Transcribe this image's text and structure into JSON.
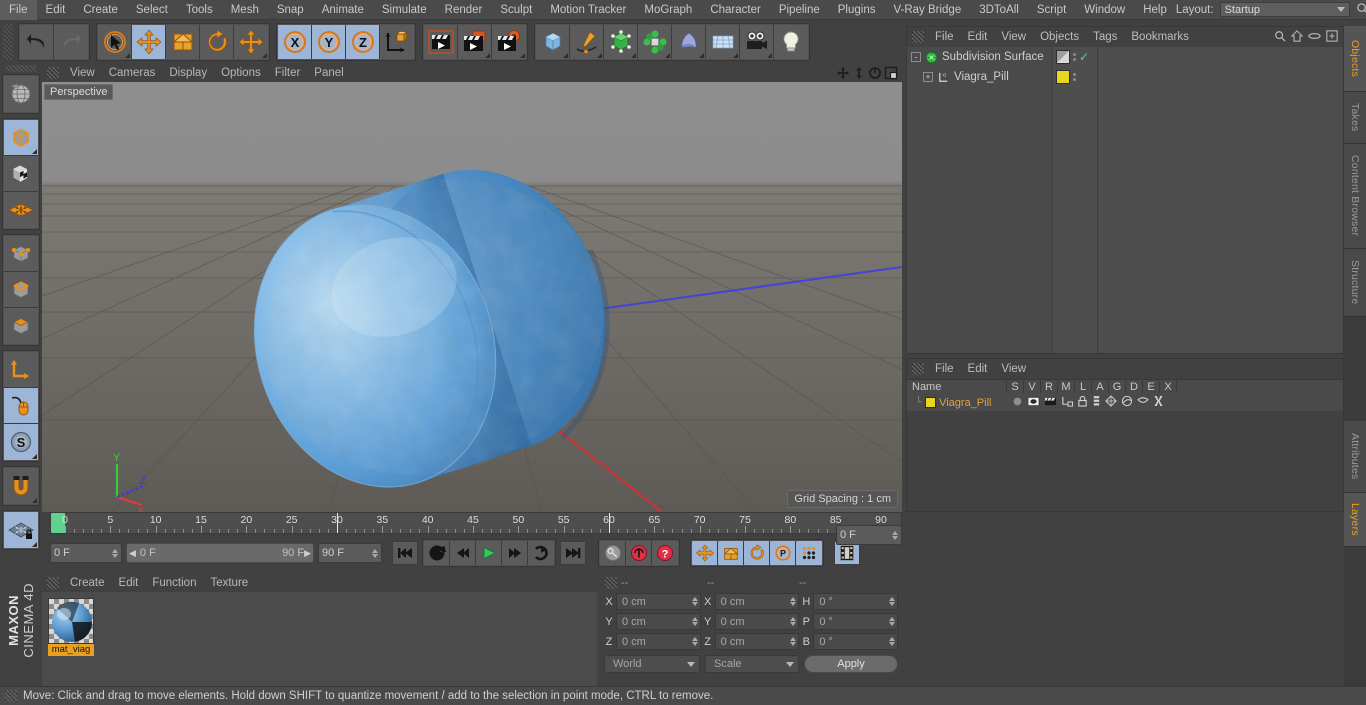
{
  "app": {
    "title": "MAXON CINEMA 4D",
    "brand_top": "MAXON",
    "brand_bottom": "CINEMA 4D"
  },
  "menubar": {
    "items": [
      {
        "label": "File"
      },
      {
        "label": "Edit"
      },
      {
        "label": "Create"
      },
      {
        "label": "Select"
      },
      {
        "label": "Tools"
      },
      {
        "label": "Mesh"
      },
      {
        "label": "Snap"
      },
      {
        "label": "Animate"
      },
      {
        "label": "Simulate"
      },
      {
        "label": "Render"
      },
      {
        "label": "Sculpt"
      },
      {
        "label": "Motion Tracker"
      },
      {
        "label": "MoGraph"
      },
      {
        "label": "Character"
      },
      {
        "label": "Pipeline"
      },
      {
        "label": "Plugins"
      },
      {
        "label": "V-Ray Bridge"
      },
      {
        "label": "3DToAll"
      },
      {
        "label": "Script"
      },
      {
        "label": "Window"
      },
      {
        "label": "Help"
      }
    ],
    "layout_label": "Layout:",
    "layout_value": "Startup",
    "search_icon": "search-icon"
  },
  "toolbar": {
    "groups": [
      {
        "name": "history",
        "buttons": [
          {
            "name": "undo-button",
            "icon": "undo-icon",
            "active": false
          },
          {
            "name": "redo-button",
            "icon": "redo-icon",
            "active": false,
            "disabled": true
          }
        ]
      },
      {
        "name": "transform-tools",
        "buttons": [
          {
            "name": "live-selection-tool",
            "icon": "arrow-cursor-icon",
            "active": false
          },
          {
            "name": "move-tool",
            "icon": "move-arrows-icon",
            "active": true
          },
          {
            "name": "scale-tool",
            "icon": "scale-box-icon",
            "active": false
          },
          {
            "name": "rotate-tool",
            "icon": "rotate-arrows-icon",
            "active": false
          },
          {
            "name": "axis-move-tool",
            "icon": "move-arrows-icon",
            "active": false
          }
        ]
      },
      {
        "name": "axis-locks",
        "buttons": [
          {
            "name": "lock-x-axis-button",
            "icon": "x-axis-icon",
            "label": "X",
            "active": true
          },
          {
            "name": "lock-y-axis-button",
            "icon": "y-axis-icon",
            "label": "Y",
            "active": true
          },
          {
            "name": "lock-z-axis-button",
            "icon": "z-axis-icon",
            "label": "Z",
            "active": true
          },
          {
            "name": "world-object-coordinates-button",
            "icon": "world-axis-cube-icon",
            "active": false
          }
        ]
      },
      {
        "name": "render-tools",
        "buttons": [
          {
            "name": "render-view-button",
            "icon": "clapper-icon",
            "active": false
          },
          {
            "name": "render-to-picture-viewer-button",
            "icon": "clapper-picture-icon",
            "active": false
          },
          {
            "name": "render-settings-button",
            "icon": "clapper-gear-icon",
            "active": false
          }
        ]
      },
      {
        "name": "create-objects",
        "buttons": [
          {
            "name": "add-cube-button",
            "icon": "cube-icon",
            "active": false
          },
          {
            "name": "add-spline-button",
            "icon": "pen-spline-icon",
            "active": false
          },
          {
            "name": "add-generator-button",
            "icon": "green-cube-icon",
            "active": false
          },
          {
            "name": "add-deformer-button",
            "icon": "green-deformer-icon",
            "active": false
          },
          {
            "name": "add-environment-button",
            "icon": "sky-shape-icon",
            "active": false
          },
          {
            "name": "add-floor-button",
            "icon": "floor-grid-icon",
            "active": false
          },
          {
            "name": "add-camera-button",
            "icon": "camera-icon",
            "active": false
          },
          {
            "name": "add-light-button",
            "icon": "lightbulb-icon",
            "active": false
          }
        ]
      }
    ]
  },
  "left_toolbar": {
    "buttons": [
      {
        "name": "undo-view-button",
        "icon": "globe-wireframe-icon",
        "active": false
      },
      {
        "name": "make-editable-button",
        "icon": "editable-cube-icon",
        "active": true
      },
      {
        "name": "texture-mode-button",
        "icon": "checker-cube-icon",
        "active": false
      },
      {
        "name": "viewport-solo-button",
        "icon": "orange-grid-plane-icon",
        "active": false
      },
      {
        "name": "points-mode-button",
        "icon": "points-cube-icon",
        "active": false
      },
      {
        "name": "edges-mode-button",
        "icon": "edges-cube-icon",
        "active": false
      },
      {
        "name": "polygons-mode-button",
        "icon": "polygon-cube-icon",
        "active": false
      },
      {
        "name": "object-axis-mode-button",
        "icon": "axis-corner-icon",
        "active": false
      },
      {
        "name": "enable-snapping-button",
        "icon": "mouse-icon",
        "active": true
      },
      {
        "name": "soft-selection-button",
        "icon": "soft-s-icon",
        "active": true
      },
      {
        "name": "magnet-tool-button",
        "icon": "magnet-icon",
        "active": false
      },
      {
        "name": "lock-workplane-button",
        "icon": "workplane-lock-icon",
        "active": true
      }
    ]
  },
  "viewport": {
    "menu": [
      "View",
      "Cameras",
      "Display",
      "Options",
      "Filter",
      "Panel"
    ],
    "camera_label": "Perspective",
    "grid_spacing": "Grid Spacing : 1 cm",
    "nav_buttons": [
      {
        "name": "pan-view-button",
        "icon": "pan-icon"
      },
      {
        "name": "dolly-view-button",
        "icon": "dolly-icon"
      },
      {
        "name": "rotate-view-button",
        "icon": "orbit-icon"
      },
      {
        "name": "maximize-view-button",
        "icon": "maximize-icon"
      }
    ],
    "axis_gizmo": {
      "x": "X",
      "y": "Y",
      "z": "Z",
      "x_color": "#e03b3b",
      "y_color": "#35cf35",
      "z_color": "#3a3ae0"
    },
    "object_color": "#5aa0dd",
    "background_top": "#8e8e8e",
    "background_bottom": "#615d59"
  },
  "timeline": {
    "ticks": [
      0,
      5,
      10,
      15,
      20,
      25,
      30,
      35,
      40,
      45,
      50,
      55,
      60,
      65,
      70,
      75,
      80,
      85,
      90
    ],
    "current_frame_field": "0 F",
    "range_start": "0 F",
    "range_end": "90 F",
    "end_frame_field": "90 F",
    "frame_field_right": "0 F",
    "playhead_frame": 0,
    "transport": [
      {
        "name": "go-to-start-button",
        "icon": "skip-start-icon"
      },
      {
        "name": "play-reverse-button",
        "icon": "play-reverse-icon"
      },
      {
        "name": "step-back-button",
        "icon": "step-back-icon"
      },
      {
        "name": "play-button",
        "icon": "play-icon"
      },
      {
        "name": "step-forward-button",
        "icon": "step-forward-icon"
      },
      {
        "name": "play-forward-loop-button",
        "icon": "loop-icon"
      },
      {
        "name": "go-to-end-button",
        "icon": "skip-end-icon"
      }
    ],
    "keyframe_tools": [
      {
        "name": "autokey-button",
        "icon": "key-icon",
        "active": false
      },
      {
        "name": "record-active-objects-button",
        "icon": "record-icon",
        "active": false
      },
      {
        "name": "keyframe-selection-button",
        "icon": "question-key-icon",
        "active": false
      }
    ],
    "record_toggles": [
      {
        "name": "record-position-button",
        "icon": "move-arrows-icon",
        "active": true
      },
      {
        "name": "record-scale-button",
        "icon": "scale-box-icon",
        "active": true
      },
      {
        "name": "record-rotation-button",
        "icon": "rotate-arrows-icon",
        "active": true
      },
      {
        "name": "record-parameter-button",
        "icon": "p-circle-icon",
        "active": true
      },
      {
        "name": "record-pla-button",
        "icon": "dots-grid-icon",
        "active": true
      },
      {
        "name": "timeline-filmstrip-button",
        "icon": "filmstrip-icon",
        "active": true
      }
    ]
  },
  "material_manager": {
    "menu": [
      "Create",
      "Edit",
      "Function",
      "Texture"
    ],
    "materials": [
      {
        "name": "mat_viagra",
        "display_name": "mat_viag",
        "color": "#5aa0dd",
        "selected": true
      }
    ]
  },
  "coordinates": {
    "header_dashes": [
      "--",
      "--",
      "--"
    ],
    "position": {
      "label_x": "X",
      "label_y": "Y",
      "label_z": "Z",
      "x": "0 cm",
      "y": "0 cm",
      "z": "0 cm"
    },
    "size": {
      "label_x": "X",
      "label_y": "Y",
      "label_z": "Z",
      "x": "0 cm",
      "y": "0 cm",
      "z": "0 cm"
    },
    "rotation": {
      "label_h": "H",
      "label_p": "P",
      "label_b": "B",
      "h": "0 °",
      "p": "0 °",
      "b": "0 °"
    },
    "coord_system": "World",
    "mode": "Scale",
    "apply_label": "Apply"
  },
  "object_manager": {
    "menu": [
      "File",
      "Edit",
      "View",
      "Objects",
      "Tags",
      "Bookmarks"
    ],
    "header_icons": [
      {
        "name": "search-icon"
      },
      {
        "name": "home-icon"
      },
      {
        "name": "ellipse-icon"
      },
      {
        "name": "new-tab-icon"
      }
    ],
    "objects": [
      {
        "name": "Subdivision Surface",
        "icon": "subdivision-surface-icon",
        "level": 1,
        "expander": "-",
        "enabled_check": true,
        "tag_color": "#9a9a9a"
      },
      {
        "name": "Viagra_Pill",
        "icon": "polygon-object-icon",
        "level": 2,
        "expander": "+",
        "enabled_check": false,
        "tag_color": "#e8d71e"
      }
    ]
  },
  "layer_manager": {
    "menu": [
      "File",
      "Edit",
      "View"
    ],
    "columns": [
      "Name",
      "S",
      "V",
      "R",
      "M",
      "L",
      "A",
      "G",
      "D",
      "E",
      "X"
    ],
    "rows": [
      {
        "name": "Viagra_Pill",
        "color": "#e8d71e"
      }
    ]
  },
  "right_tabs": {
    "upper": [
      {
        "label": "Objects",
        "active": true
      },
      {
        "label": "Takes",
        "active": false
      },
      {
        "label": "Content Browser",
        "active": false
      },
      {
        "label": "Structure",
        "active": false
      }
    ],
    "lower": [
      {
        "label": "Attributes",
        "active": false
      },
      {
        "label": "Layers",
        "active": true
      }
    ]
  },
  "statusbar": {
    "message": "Move: Click and drag to move elements. Hold down SHIFT to quantize movement / add to the selection in point mode, CTRL to remove."
  },
  "colors": {
    "panel_bg": "#414141",
    "panel_alt": "#4a4a4a",
    "button_bg": "#5b5b5b",
    "accent_blue": "#9db5d6",
    "accent_orange": "#e8a020",
    "text": "#c8c8c8"
  }
}
